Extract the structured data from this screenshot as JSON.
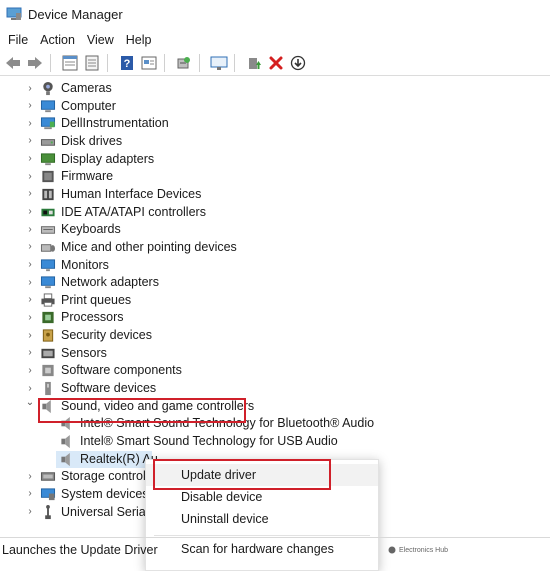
{
  "window": {
    "title": "Device Manager"
  },
  "menu": [
    "File",
    "Action",
    "View",
    "Help"
  ],
  "toolbar": [
    "back-icon",
    "forward-icon",
    "properties-grid-icon",
    "view-icon",
    "help-icon",
    "update-view-icon",
    "scan-icon",
    "monitor-icon",
    "enable-device-icon",
    "uninstall-icon",
    "download-icon"
  ],
  "tree": {
    "items": [
      {
        "label": "Cameras",
        "icon": "camera-icon"
      },
      {
        "label": "Computer",
        "icon": "computer-icon"
      },
      {
        "label": "DellInstrumentation",
        "icon": "dell-instrumentation-icon"
      },
      {
        "label": "Disk drives",
        "icon": "disk-drive-icon"
      },
      {
        "label": "Display adapters",
        "icon": "display-adapter-icon"
      },
      {
        "label": "Firmware",
        "icon": "firmware-icon"
      },
      {
        "label": "Human Interface Devices",
        "icon": "hid-icon"
      },
      {
        "label": "IDE ATA/ATAPI controllers",
        "icon": "ide-controller-icon"
      },
      {
        "label": "Keyboards",
        "icon": "keyboard-icon"
      },
      {
        "label": "Mice and other pointing devices",
        "icon": "mouse-icon"
      },
      {
        "label": "Monitors",
        "icon": "monitor-icon"
      },
      {
        "label": "Network adapters",
        "icon": "network-adapter-icon"
      },
      {
        "label": "Print queues",
        "icon": "printer-icon"
      },
      {
        "label": "Processors",
        "icon": "processor-icon"
      },
      {
        "label": "Security devices",
        "icon": "security-device-icon"
      },
      {
        "label": "Sensors",
        "icon": "sensor-icon"
      },
      {
        "label": "Software components",
        "icon": "software-component-icon"
      },
      {
        "label": "Software devices",
        "icon": "software-device-icon"
      },
      {
        "label": "Sound, video and game controllers",
        "icon": "speaker-icon",
        "expanded": true
      },
      {
        "label": "Intel® Smart Sound Technology for Bluetooth® Audio",
        "icon": "speaker-icon",
        "child": true
      },
      {
        "label": "Intel® Smart Sound Technology for USB Audio",
        "icon": "speaker-icon",
        "child": true
      },
      {
        "label": "Realtek(R) Au",
        "icon": "speaker-icon",
        "child": true,
        "selected": true
      },
      {
        "label": "Storage controlle",
        "icon": "storage-controller-icon"
      },
      {
        "label": "System devices",
        "icon": "system-device-icon"
      },
      {
        "label": "Universal Serial I",
        "icon": "usb-icon"
      }
    ]
  },
  "context_menu": {
    "items": [
      "Update driver",
      "Disable device",
      "Uninstall device",
      "Scan for hardware changes"
    ]
  },
  "status": {
    "text": "Launches the Update Driver"
  },
  "watermark": {
    "text": "Electronics Hub"
  },
  "colors": {
    "highlight_box": "#d0202a",
    "selection": "#d9e9f8",
    "accent": "#2f6fb5"
  }
}
